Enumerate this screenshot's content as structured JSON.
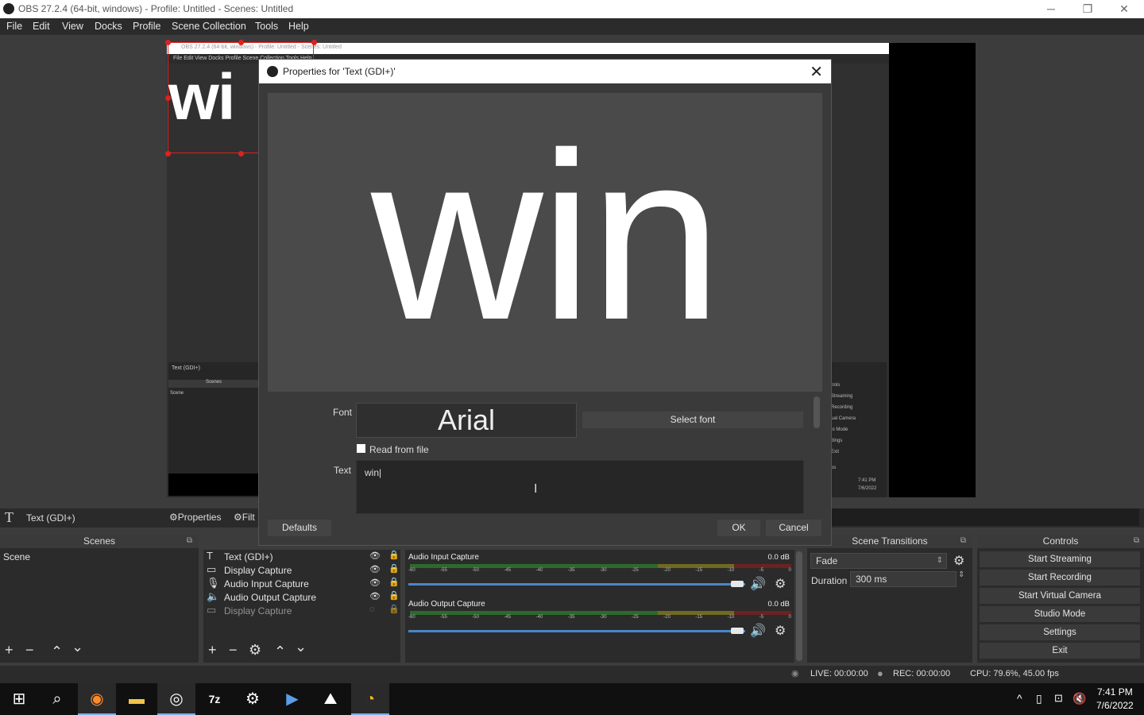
{
  "window": {
    "title": "OBS 27.2.4 (64-bit, windows) - Profile: Untitled - Scenes: Untitled",
    "minimize": "─",
    "maximize": "❐",
    "close": "✕"
  },
  "menu": [
    "File",
    "Edit",
    "View",
    "Docks",
    "Profile",
    "Scene Collection",
    "Tools",
    "Help"
  ],
  "nested": {
    "title": "OBS 27.2.4 (64-bit, windows) - Profile: Untitled - Scenes: Untitled",
    "menu": "File   Edit   View   Docks   Profile   Scene Collection   Tools   Help",
    "big_text": "wi",
    "source": "Text (GDI+)",
    "scenes": "Scenes",
    "scene": "Scene",
    "controls": [
      "trols",
      "Streaming",
      "Recording",
      "ual Camera",
      "io Mode",
      "ttings",
      "Exit",
      "ps"
    ],
    "clock_time": "7:41 PM",
    "clock_date": "7/6/2022"
  },
  "source_toolbar": {
    "icon": "T",
    "name": "Text (GDI+)",
    "properties": "Properties",
    "filters": "Filt"
  },
  "scenes_dock": {
    "title": "Scenes",
    "items": [
      "Scene"
    ],
    "buttons": [
      "+",
      "−",
      "⌃",
      "⌄"
    ]
  },
  "sources_dock": {
    "items": [
      {
        "icon": "T",
        "name": "Text (GDI+)",
        "eye": "👁",
        "lock": "🔒"
      },
      {
        "icon": "▭",
        "name": "Display Capture",
        "eye": "👁",
        "lock": "🔒"
      },
      {
        "icon": "🎙",
        "name": "Audio Input Capture",
        "eye": "👁",
        "lock": "🔒"
      },
      {
        "icon": "🔈",
        "name": "Audio Output Capture",
        "eye": "👁",
        "lock": "🔒"
      },
      {
        "icon": "▭",
        "name": "Display Capture",
        "eye": "◌",
        "lock": "🔒"
      }
    ],
    "buttons": [
      "+",
      "−",
      "⚙",
      "⌃",
      "⌄"
    ]
  },
  "mixer": {
    "ticks": [
      "-60",
      "-55",
      "-50",
      "-45",
      "-40",
      "-35",
      "-30",
      "-25",
      "-20",
      "-15",
      "-10",
      "-5",
      "0"
    ],
    "channels": [
      {
        "name": "Audio Input Capture",
        "db": "0.0 dB",
        "level": 0.95
      },
      {
        "name": "Audio Output Capture",
        "db": "0.0 dB",
        "level": 0.95
      }
    ]
  },
  "transitions": {
    "title": "Scene Transitions",
    "selected": "Fade",
    "duration_label": "Duration",
    "duration_value": "300 ms"
  },
  "controls": {
    "title": "Controls",
    "buttons": [
      "Start Streaming",
      "Start Recording",
      "Start Virtual Camera",
      "Studio Mode",
      "Settings",
      "Exit"
    ]
  },
  "status": {
    "live": "LIVE: 00:00:00",
    "rec": "REC: 00:00:00",
    "cpu": "CPU: 79.6%, 45.00 fps"
  },
  "dialog": {
    "title": "Properties for 'Text (GDI+)'",
    "preview_text": "win",
    "font_label": "Font",
    "font_value": "Arial",
    "select_font": "Select font",
    "read_from_file": "Read from file",
    "text_label": "Text",
    "text_value": "win",
    "defaults": "Defaults",
    "ok": "OK",
    "cancel": "Cancel"
  },
  "taskbar": {
    "clock_time": "7:41 PM",
    "clock_date": "7/6/2022"
  },
  "colors": {
    "accent": "#4a86c8",
    "selection": "#e02020"
  }
}
